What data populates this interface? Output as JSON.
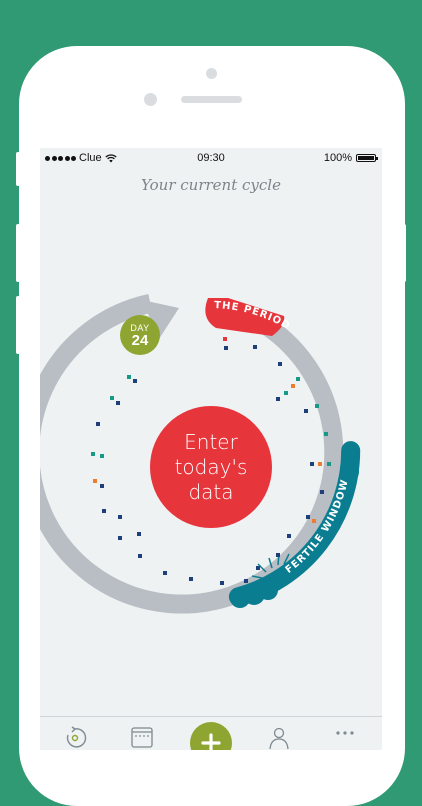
{
  "status_bar": {
    "carrier": "Clue",
    "time": "09:30",
    "battery": "100%"
  },
  "header": {
    "title": "Your current cycle"
  },
  "cycle": {
    "day_label": "DAY",
    "day_number": "24",
    "center_button_lines": [
      "Enter",
      "today's",
      "data"
    ],
    "period_label": "THE PERIOD",
    "fertile_label": "FERTILE WINDOW"
  },
  "colors": {
    "background": "#2f9a73",
    "screen": "#eef2f3",
    "period": "#e7353c",
    "day_badge": "#8fa531",
    "fertile": "#0b7d91",
    "ring": "#b8bec3",
    "dot_navy": "#1f3f7a",
    "dot_teal": "#169a86",
    "dot_orange": "#ef7b2f"
  },
  "tab_bar": {
    "items": [
      {
        "name": "cycle-tab",
        "icon": "cycle-icon"
      },
      {
        "name": "calendar-tab",
        "icon": "calendar-icon"
      },
      {
        "name": "add-tab",
        "icon": "plus-icon"
      },
      {
        "name": "profile-tab",
        "icon": "profile-icon"
      },
      {
        "name": "more-tab",
        "icon": "more-dots-icon"
      }
    ]
  }
}
